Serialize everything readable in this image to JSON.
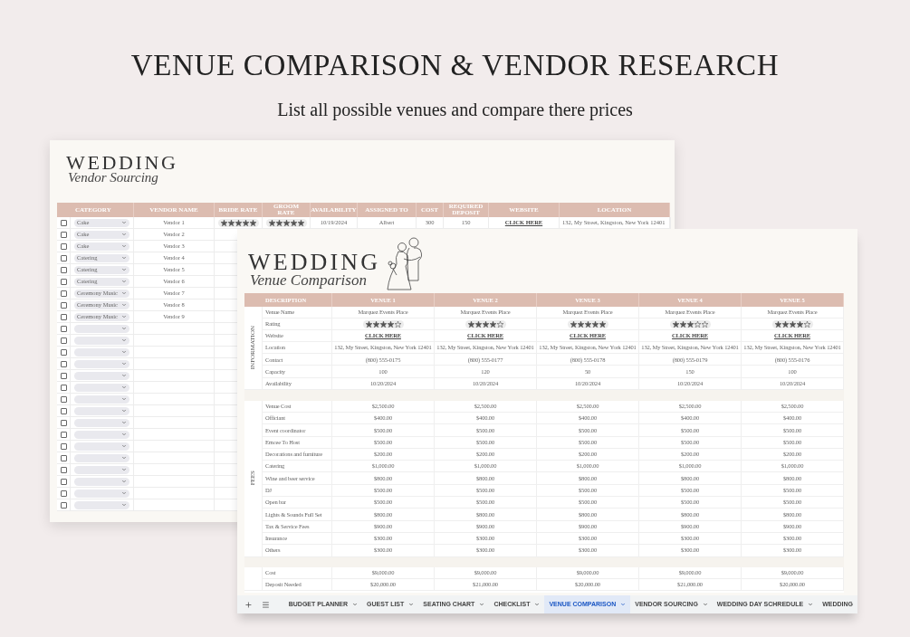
{
  "heading": {
    "title": "VENUE COMPARISON & VENDOR RESEARCH",
    "subtitle": "List all possible venues and compare there prices"
  },
  "vendor_sheet": {
    "logo_title": "WEDDING",
    "logo_subtitle": "Vendor Sourcing",
    "columns": [
      "CATEGORY",
      "VENDOR NAME",
      "BRIDE RATE",
      "GROOM RATE",
      "AVAILABILITY",
      "ASSIGNED TO",
      "COST",
      "REQUIRED DEPOSIT",
      "WEBSITE",
      "LOCATION"
    ],
    "rows": [
      {
        "checked": false,
        "category": "Cake",
        "vendor_name": "Vendor 1",
        "bride_rate": {
          "stars": 5
        },
        "groom_rate": {
          "stars": 5
        },
        "availability": "10/19/2024",
        "assigned_to": "Albert",
        "cost": "300",
        "required_deposit": "150",
        "website": "CLICK HERE",
        "location": "132, My Street, Kingston, New York 12401"
      },
      {
        "checked": false,
        "category": "Cake",
        "vendor_name": "Vendor 2"
      },
      {
        "checked": false,
        "category": "Cake",
        "vendor_name": "Vendor 3"
      },
      {
        "checked": false,
        "category": "Catering",
        "vendor_name": "Vendor 4"
      },
      {
        "checked": false,
        "category": "Catering",
        "vendor_name": "Vendor 5"
      },
      {
        "checked": false,
        "category": "Catering",
        "vendor_name": "Vendor 6"
      },
      {
        "checked": false,
        "category": "Ceremony Music",
        "vendor_name": "Vendor 7"
      },
      {
        "checked": false,
        "category": "Ceremony Music",
        "vendor_name": "Vendor 8"
      },
      {
        "checked": false,
        "category": "Ceremony Music",
        "vendor_name": "Vendor 9"
      },
      {
        "checked": false
      },
      {
        "checked": false
      },
      {
        "checked": false
      },
      {
        "checked": false
      },
      {
        "checked": false
      },
      {
        "checked": false
      },
      {
        "checked": false
      },
      {
        "checked": false
      },
      {
        "checked": false
      },
      {
        "checked": false
      },
      {
        "checked": false
      },
      {
        "checked": false
      },
      {
        "checked": false
      },
      {
        "checked": false
      },
      {
        "checked": false
      },
      {
        "checked": false
      }
    ]
  },
  "venue_sheet": {
    "logo_title": "WEDDING",
    "logo_subtitle": "Venue Comparison",
    "columns": [
      "DESCRIPTION",
      "VENUE 1",
      "VENUE 2",
      "VENUE 3",
      "VENUE 4",
      "VENUE 5"
    ],
    "sections": [
      {
        "label": "INFORMATION",
        "rows": [
          {
            "kind": "text",
            "label": "Venue Name",
            "values": [
              "Marquez Events Place",
              "Marquez Events Place",
              "Marquez Events Place",
              "Marquez Events Place",
              "Marquez Events Place"
            ]
          },
          {
            "kind": "rating",
            "label": "Rating",
            "values": [
              {
                "stars": 4
              },
              {
                "stars": 4
              },
              {
                "stars": 5
              },
              {
                "stars": 3
              },
              {
                "stars": 4
              }
            ]
          },
          {
            "kind": "link",
            "label": "Website",
            "values": [
              "CLICK HERE",
              "CLICK HERE",
              "CLICK HERE",
              "CLICK HERE",
              "CLICK HERE"
            ]
          },
          {
            "kind": "text",
            "label": "Location",
            "values": [
              "132, My Street, Kingston, New York 12401",
              "132, My Street, Kingston, New York 12401",
              "132, My Street, Kingston, New York 12401",
              "132, My Street, Kingston, New York 12401",
              "132, My Street, Kingston, New York 12401"
            ]
          },
          {
            "kind": "text",
            "label": "Contact",
            "values": [
              "(800) 555-0175",
              "(800) 555-0177",
              "(800) 555-0178",
              "(800) 555-0179",
              "(800) 555-0176"
            ]
          },
          {
            "kind": "text",
            "label": "Capacity",
            "values": [
              "100",
              "120",
              "50",
              "150",
              "100"
            ]
          },
          {
            "kind": "text",
            "label": "Availability",
            "values": [
              "10/20/2024",
              "10/20/2024",
              "10/20/2024",
              "10/20/2024",
              "10/20/2024"
            ]
          }
        ]
      },
      {
        "label": "FEES",
        "rows": [
          {
            "kind": "text",
            "label": "Venue Cost",
            "values": [
              "$2,500.00",
              "$2,500.00",
              "$2,500.00",
              "$2,500.00",
              "$2,500.00"
            ]
          },
          {
            "kind": "text",
            "label": "Officiant",
            "values": [
              "$400.00",
              "$400.00",
              "$400.00",
              "$400.00",
              "$400.00"
            ]
          },
          {
            "kind": "text",
            "label": "Event coordinator",
            "values": [
              "$500.00",
              "$500.00",
              "$500.00",
              "$500.00",
              "$500.00"
            ]
          },
          {
            "kind": "text",
            "label": "Emcee To Host",
            "values": [
              "$500.00",
              "$500.00",
              "$500.00",
              "$500.00",
              "$500.00"
            ]
          },
          {
            "kind": "text",
            "label": "Decorations and furniture",
            "values": [
              "$200.00",
              "$200.00",
              "$200.00",
              "$200.00",
              "$200.00"
            ]
          },
          {
            "kind": "text",
            "label": "Catering",
            "values": [
              "$1,000.00",
              "$1,000.00",
              "$1,000.00",
              "$1,000.00",
              "$1,000.00"
            ]
          },
          {
            "kind": "text",
            "label": "Wine and beer service",
            "values": [
              "$800.00",
              "$800.00",
              "$800.00",
              "$800.00",
              "$800.00"
            ]
          },
          {
            "kind": "text",
            "label": "DJ",
            "values": [
              "$500.00",
              "$500.00",
              "$500.00",
              "$500.00",
              "$500.00"
            ]
          },
          {
            "kind": "text",
            "label": "Open bar",
            "values": [
              "$500.00",
              "$500.00",
              "$500.00",
              "$500.00",
              "$500.00"
            ]
          },
          {
            "kind": "text",
            "label": "Lights & Sounds Full Set",
            "values": [
              "$800.00",
              "$800.00",
              "$800.00",
              "$800.00",
              "$800.00"
            ]
          },
          {
            "kind": "text",
            "label": "Tax & Service Fees",
            "values": [
              "$900.00",
              "$900.00",
              "$900.00",
              "$900.00",
              "$900.00"
            ]
          },
          {
            "kind": "text",
            "label": "Insurance",
            "values": [
              "$300.00",
              "$300.00",
              "$300.00",
              "$300.00",
              "$300.00"
            ]
          },
          {
            "kind": "text",
            "label": "Others",
            "values": [
              "$300.00",
              "$300.00",
              "$300.00",
              "$300.00",
              "$300.00"
            ]
          }
        ]
      },
      {
        "rows": [
          {
            "kind": "text",
            "label": "Cost",
            "values": [
              "$9,000.00",
              "$9,000.00",
              "$9,000.00",
              "$9,000.00",
              "$9,000.00"
            ]
          },
          {
            "kind": "text",
            "label": "Deposit Needed",
            "values": [
              "$20,000.00",
              "$21,000.00",
              "$20,000.00",
              "$21,000.00",
              "$20,000.00"
            ]
          }
        ]
      }
    ]
  },
  "sheet_tabs": [
    {
      "label": "BUDGET PLANNER",
      "selected": false,
      "menu": true
    },
    {
      "label": "GUEST LIST",
      "selected": false,
      "menu": true
    },
    {
      "label": "SEATING CHART",
      "selected": false,
      "menu": true
    },
    {
      "label": "CHECKLIST",
      "selected": false,
      "menu": true
    },
    {
      "label": "VENUE COMPARISON",
      "selected": true,
      "menu": true
    },
    {
      "label": "VENDOR SOURCING",
      "selected": false,
      "menu": true
    },
    {
      "label": "WEDDING DAY SCHREDULE",
      "selected": false,
      "menu": true
    },
    {
      "label": "WEDDING",
      "selected": false,
      "menu": false
    }
  ]
}
